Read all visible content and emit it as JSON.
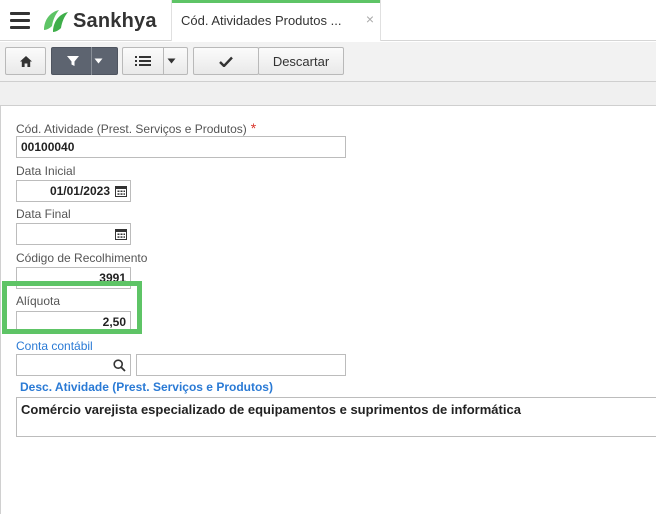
{
  "header": {
    "logo_text": "Sankhya",
    "tab_label": "Cód. Atividades Produtos ...",
    "tab_close": "×"
  },
  "toolbar": {
    "discard_label": "Descartar"
  },
  "form": {
    "cod_atividade": {
      "label": "Cód. Atividade (Prest. Serviços e Produtos)",
      "required_mark": "*",
      "value": "00100040"
    },
    "data_inicial": {
      "label": "Data Inicial",
      "value": "01/01/2023"
    },
    "data_final": {
      "label": "Data Final",
      "value": ""
    },
    "codigo_recolhimento": {
      "label": "Código de Recolhimento",
      "value": "3991"
    },
    "aliquota": {
      "label": "Alíquota",
      "value": "2,50"
    },
    "conta_contabil": {
      "label": "Conta contábil",
      "code_value": "",
      "desc_value": ""
    },
    "desc_atividade": {
      "label": "Desc. Atividade (Prest. Serviços e Produtos)",
      "value": "Comércio varejista especializado de equipamentos e suprimentos de informática"
    }
  },
  "colors": {
    "accent_green": "#5ec466",
    "link_blue": "#2a7ad5",
    "required_red": "#d9342b",
    "toolbar_dark": "#5d6470"
  }
}
